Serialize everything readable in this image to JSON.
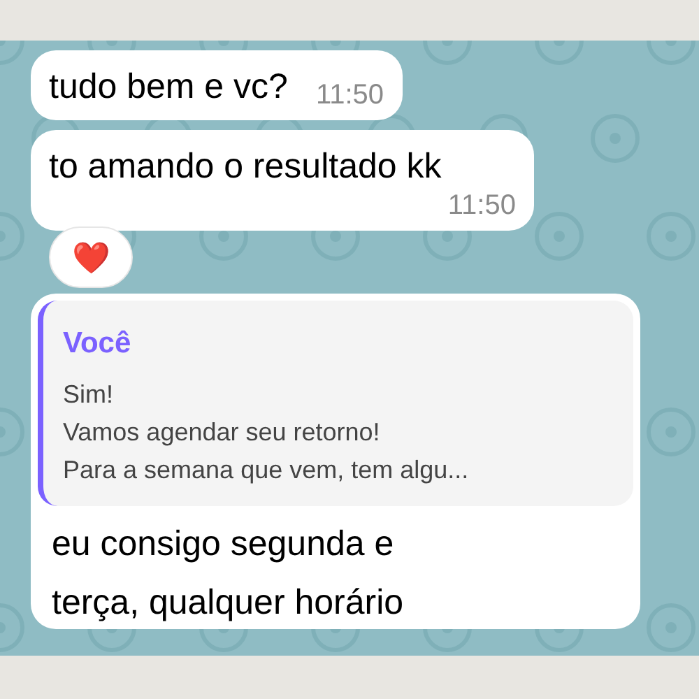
{
  "messages": [
    {
      "kind": "text",
      "text": "tudo bem e vc?",
      "time": "11:50"
    },
    {
      "kind": "text",
      "text": "to amando o resultado kk",
      "time": "11:50",
      "reaction": "❤️"
    },
    {
      "kind": "reply",
      "quote": {
        "author": "Você",
        "lines": [
          "Sim!",
          "Vamos agendar seu retorno!",
          "Para a semana que vem, tem algu..."
        ]
      },
      "text": "eu consigo segunda e terça, qualquer horário"
    }
  ]
}
